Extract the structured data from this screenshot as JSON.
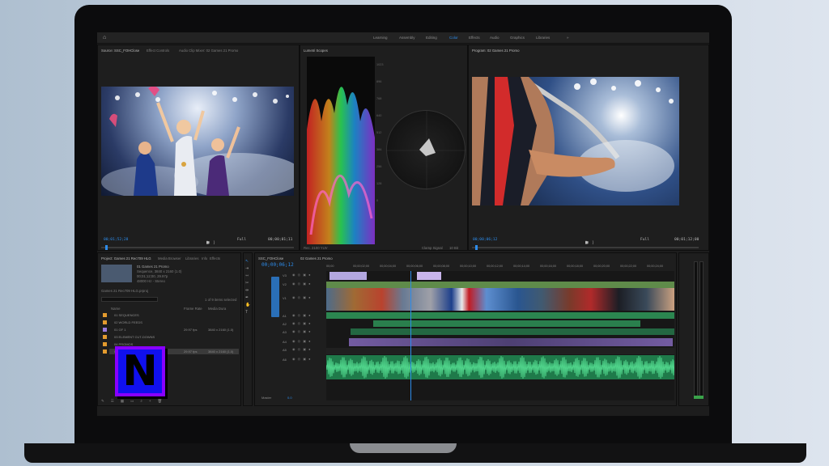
{
  "topbar": {
    "workspaces": [
      "Learning",
      "Assembly",
      "Editing",
      "Color",
      "Effects",
      "Audio",
      "Graphics",
      "Libraries"
    ],
    "active": "Color",
    "more": "»"
  },
  "source": {
    "title": "Source: SSC_FOHClose",
    "tabs": [
      "Effect Controls",
      "Audio Clip Mixer: 02 Games 21 Promo"
    ],
    "tc_left": "00;01;52;28",
    "tc_right": "00;00;01;11",
    "fit": "Full"
  },
  "lumetri": {
    "title": "Lumetri Scopes",
    "footer": "Rec. 2100 YUV",
    "clamp": "Clamp Signal",
    "bits": "10 Bit"
  },
  "program": {
    "title": "Program: 02 Games 21 Promo",
    "tc_left": "00;00;06;12",
    "tc_right": "00;01;12;00",
    "fit": "Full"
  },
  "project": {
    "tabs": [
      "Project: Games 21 Rec709 HLG",
      "Media Browser",
      "Libraries",
      "Info",
      "Effects"
    ],
    "clip_name": "01 Games 21 Promo",
    "meta": [
      "Sequence, 3840 x 2160 (1.0)",
      "00;01;12;00, 29.97p",
      "48000 Hz - Stereo",
      "6 items selected"
    ],
    "search_path": "Games 21 Rec709 HLG.prproj",
    "items_count": "1 of 9 items selected",
    "cols": [
      "Name",
      "Frame Rate",
      "Media Dura"
    ],
    "rows": [
      {
        "name": "01 SEQUENCES",
        "fr": "",
        "dur": ""
      },
      {
        "name": "02 WORLD FEEDS",
        "fr": "",
        "dur": ""
      },
      {
        "name": "01 GF 1",
        "fr": "29.97 fps",
        "dur": "3840 x 2160 (1.0)"
      },
      {
        "name": "03 ELEMENT CUT-DOWNS",
        "fr": "",
        "dur": ""
      },
      {
        "name": "04 PROMOS",
        "fr": "",
        "dur": ""
      },
      {
        "name": "02 Games 21 Promo",
        "fr": "29.97 fps",
        "dur": "3840 x 2160 (1.0)"
      }
    ]
  },
  "timeline": {
    "tabs": [
      "SSC_FOHClose",
      "02 Games 21 Promo"
    ],
    "tc": "00;00;06;12",
    "ruler": [
      "00;00",
      "00;00;02;00",
      "00;00;04;00",
      "00;00;06;00",
      "00;00;08;00",
      "00;00;10;00",
      "00;00;12;00",
      "00;00;14;00",
      "00;00;16;00",
      "00;00;18;00",
      "00;00;20;00",
      "00;00;22;00",
      "00;00;24;00"
    ],
    "tracks": [
      "V3",
      "V2",
      "V1",
      "A1",
      "A2",
      "A3",
      "A4",
      "A5",
      "A6"
    ],
    "mix": "Master",
    "mix_val": "0.0",
    "video_label": "Video 1",
    "audio_label": "Audio 1"
  },
  "overlay": {
    "letter": "N"
  }
}
